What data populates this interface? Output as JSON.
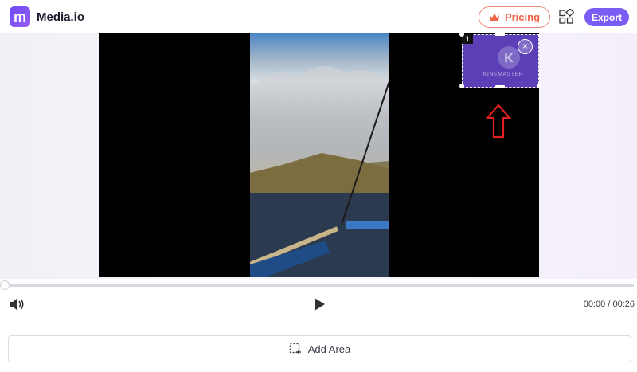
{
  "header": {
    "app_name": "Media.io",
    "logo_letter": "m",
    "pricing_label": "Pricing",
    "export_label": "Export",
    "icons": {
      "logo": "media-io-logo",
      "pricing": "crown-icon",
      "apps": "apps-grid-icon"
    }
  },
  "canvas": {
    "watermark": {
      "index": "1",
      "text": "KINEMASTER",
      "close_glyph": "×",
      "icon": "kinemaster-logo"
    },
    "hint_arrow_icon": "red-up-arrow-icon"
  },
  "player": {
    "current_time": "00:00",
    "separator": "/",
    "duration": "00:26",
    "progress": 0,
    "icons": {
      "volume": "volume-icon",
      "play": "play-icon"
    }
  },
  "actions": {
    "add_area_label": "Add Area",
    "add_area_icon": "add-selection-icon"
  },
  "colors": {
    "accent": "#7b5cf5",
    "pricing": "#f06449",
    "watermark_bg": "#5b3fb6",
    "arrow": "#e02020"
  }
}
